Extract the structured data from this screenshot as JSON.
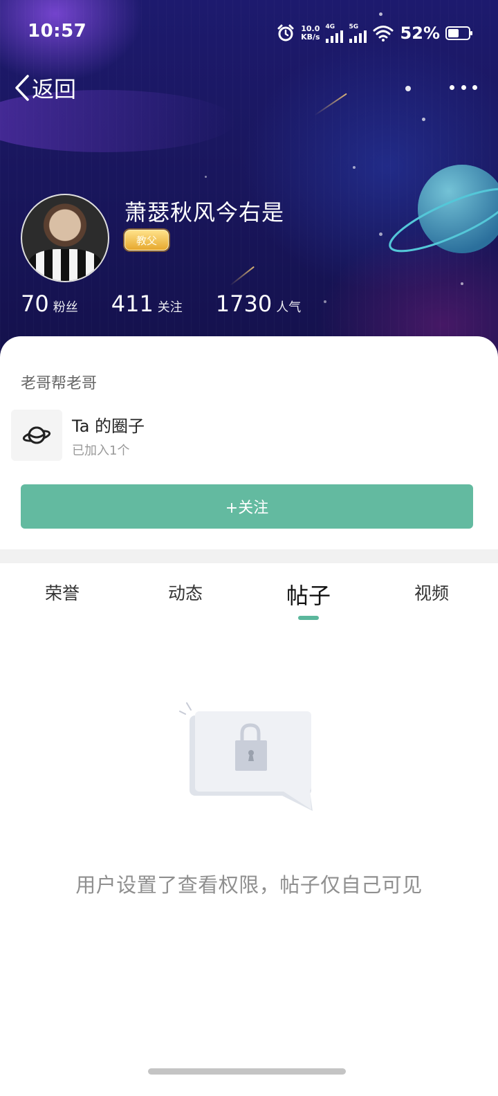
{
  "status_bar": {
    "time": "10:57",
    "net_speed_value": "10.0",
    "net_speed_unit": "KB/s",
    "sim1_tag": "4G",
    "sim2_tag": "5G",
    "battery_percent": "52%",
    "battery_level": 0.52
  },
  "nav": {
    "back_label": "返回"
  },
  "profile": {
    "username": "萧瑟秋风今右是",
    "badge": "教父",
    "stats": [
      {
        "value": "70",
        "label": "粉丝"
      },
      {
        "value": "411",
        "label": "关注"
      },
      {
        "value": "1730",
        "label": "人气"
      }
    ]
  },
  "card": {
    "team_name": "老哥帮老哥",
    "circle_title": "Ta 的圈子",
    "circle_sub": "已加入1个",
    "follow_label": "+关注"
  },
  "tabs": {
    "items": [
      "荣誉",
      "动态",
      "帖子",
      "视频"
    ],
    "active": "帖子"
  },
  "empty": {
    "message": "用户设置了查看权限，帖子仅自己可见"
  },
  "colors": {
    "accent": "#63baa0",
    "hero_bg": "#1a1760"
  }
}
